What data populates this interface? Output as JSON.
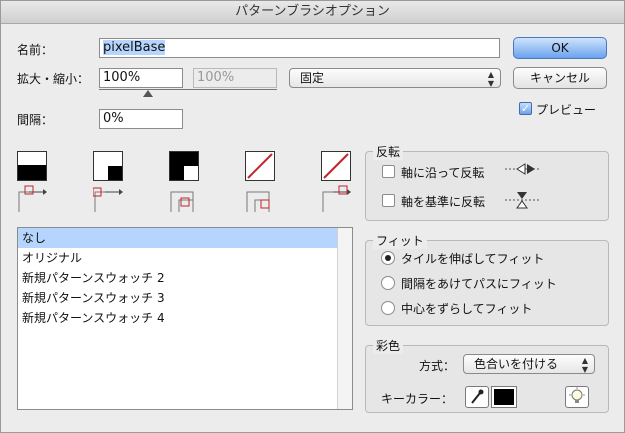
{
  "window": {
    "title": "パターンブラシオプション"
  },
  "name": {
    "label": "名前：",
    "value": "pixelBase"
  },
  "scale": {
    "label": "拡大・縮小：",
    "value": "100%",
    "value2": "100%",
    "mode": "固定"
  },
  "spacing": {
    "label": "間隔：",
    "value": "0%"
  },
  "buttons": {
    "ok": "OK",
    "cancel": "キャンセル"
  },
  "preview": {
    "label": "プレビュー",
    "checked": true
  },
  "flip": {
    "title": "反転",
    "along": "軸に沿って反転",
    "across": "軸を基準に反転"
  },
  "pattern_list": {
    "items": [
      "なし",
      "オリジナル",
      "新規パターンスウォッチ 2",
      "新規パターンスウォッチ 3",
      "新規パターンスウォッチ 4"
    ],
    "selected": "なし"
  },
  "fit": {
    "title": "フィット",
    "options": [
      "タイルを伸ばしてフィット",
      "間隔をあけてパスにフィット",
      "中心をずらしてフィット"
    ],
    "selected": "タイルを伸ばしてフィット"
  },
  "colorization": {
    "title": "彩色",
    "method_label": "方式：",
    "method_value": "色合いを付ける",
    "keycolor_label": "キーカラー：",
    "keycolor": "#000000"
  }
}
